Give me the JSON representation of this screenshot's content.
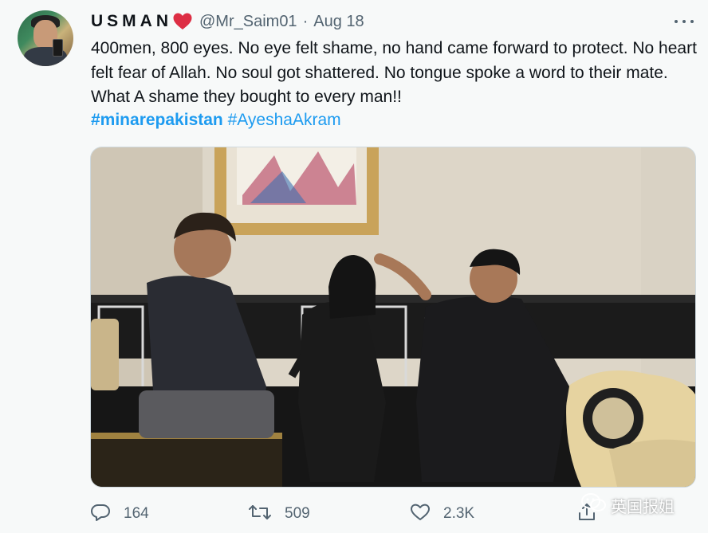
{
  "tweet": {
    "display_name": "USMAN",
    "handle": "@Mr_Saim01",
    "separator": "·",
    "date": "Aug 18",
    "text": "400men, 800 eyes.  No eye felt shame, no hand came forward to protect.  No heart felt fear of Allah.  No soul got shattered.  No tongue spoke a word to their mate. What A shame they bought to every man!!",
    "hashtags": [
      "#minarepakistan",
      "#AyeshaAkram"
    ]
  },
  "actions": {
    "reply_count": "164",
    "retweet_count": "509",
    "like_count": "2.3K"
  },
  "watermark": {
    "text": "英国报姐"
  },
  "icons": {
    "heart": "red-heart-emoji",
    "more": "more-options-icon",
    "reply": "reply-icon",
    "retweet": "retweet-icon",
    "like": "like-icon",
    "share": "share-icon"
  },
  "colors": {
    "link": "#1d9bf0",
    "secondary_text": "#536471",
    "heart": "#e0245e"
  }
}
